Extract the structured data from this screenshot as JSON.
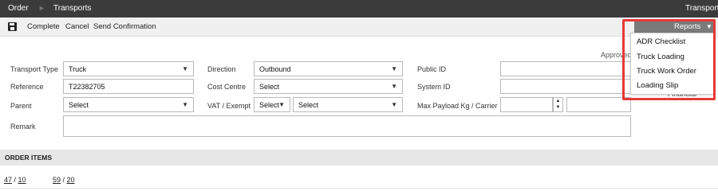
{
  "topbar": {
    "breadcrumbs": [
      "Order",
      "Transports"
    ],
    "right_title": "Transport"
  },
  "toolbar": {
    "complete_label": "Complete",
    "cancel_label": "Cancel",
    "send_confirmation_label": "Send Confirmation",
    "reports_label": "Reports"
  },
  "reports_menu": {
    "items": [
      "ADR Checklist",
      "Truck Loading",
      "Truck Work Order",
      "Loading Slip"
    ]
  },
  "form": {
    "approved_label": "Approved",
    "transport_type": {
      "label": "Transport Type",
      "value": "Truck"
    },
    "reference": {
      "label": "Reference",
      "value": "T22382705"
    },
    "parent": {
      "label": "Parent",
      "value": "Select"
    },
    "remark": {
      "label": "Remark",
      "value": ""
    },
    "direction": {
      "label": "Direction",
      "value": "Outbound"
    },
    "cost_centre": {
      "label": "Cost Centre",
      "value": "Select"
    },
    "vat_exempt": {
      "label": "VAT / Exempt",
      "vat_value": "Select",
      "exempt_value": "Select"
    },
    "public_id": {
      "label": "Public ID",
      "value": ""
    },
    "system_id": {
      "label": "System ID",
      "value": ""
    },
    "max_payload": {
      "label": "Max Payload Kg / Carrier",
      "payload_value": "",
      "carrier_value": ""
    },
    "financial_label": "Financial"
  },
  "order_items": {
    "title": "ORDER ITEMS",
    "pager": {
      "first": {
        "current": "47",
        "total": "10"
      },
      "second": {
        "current": "59",
        "total": "20"
      }
    }
  }
}
